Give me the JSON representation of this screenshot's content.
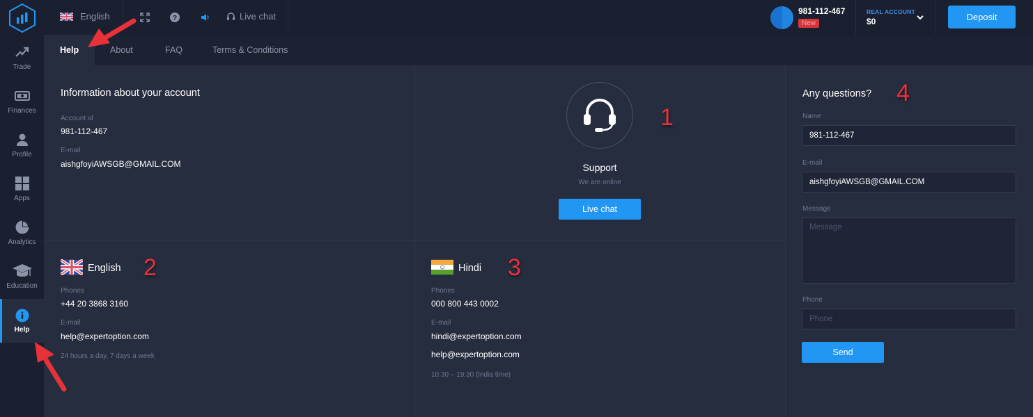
{
  "topbar": {
    "language": "English",
    "live_chat": "Live chat",
    "account_id": "981-112-467",
    "new_badge": "New",
    "account_type": "REAL ACCOUNT",
    "balance": "$0",
    "deposit": "Deposit",
    "icons": [
      "logo-icon",
      "uk-flag-icon",
      "fullscreen-icon",
      "help-icon",
      "sound-icon",
      "headset-icon",
      "chevron-down-icon"
    ]
  },
  "sidebar": {
    "items": [
      {
        "label": "Trade",
        "icon": "trend-up-icon"
      },
      {
        "label": "Finances",
        "icon": "banknote-icon"
      },
      {
        "label": "Profile",
        "icon": "user-icon"
      },
      {
        "label": "Apps",
        "icon": "grid-icon"
      },
      {
        "label": "Analytics",
        "icon": "pie-chart-icon"
      },
      {
        "label": "Education",
        "icon": "graduation-cap-icon"
      },
      {
        "label": "Help",
        "icon": "info-icon",
        "active": true
      }
    ]
  },
  "tabs": [
    {
      "label": "Help",
      "active": true
    },
    {
      "label": "About"
    },
    {
      "label": "FAQ"
    },
    {
      "label": "Terms & Conditions"
    }
  ],
  "account_info": {
    "title": "Information about your account",
    "account_id_label": "Account id",
    "account_id": "981-112-467",
    "email_label": "E-mail",
    "email": "aishgfoyiAWSGB@GMAIL.COM"
  },
  "support": {
    "title": "Support",
    "status": "We are online",
    "button": "Live chat"
  },
  "english_contact": {
    "language": "English",
    "phones_label": "Phones",
    "phone": "+44 20 3868 3160",
    "email_label": "E-mail",
    "email": "help@expertoption.com",
    "hours": "24 hours a day, 7 days a week"
  },
  "hindi_contact": {
    "language": "Hindi",
    "phones_label": "Phones",
    "phone": "000 800 443 0002",
    "email_label": "E-mail",
    "emails": [
      "hindi@expertoption.com",
      "help@expertoption.com"
    ],
    "hours": "10:30 – 19:30 (India time)"
  },
  "questions_form": {
    "title": "Any questions?",
    "name_label": "Name",
    "name_value": "981-112-467",
    "email_label": "E-mail",
    "email_value": "aishgfoyiAWSGB@GMAIL.COM",
    "message_label": "Message",
    "message_placeholder": "Message",
    "phone_label": "Phone",
    "phone_placeholder": "Phone",
    "send": "Send"
  },
  "annotations": [
    "1",
    "2",
    "3",
    "4"
  ],
  "colors": {
    "accent": "#2196f3",
    "background": "#232a3b",
    "topbar": "#1b2030",
    "badge_red": "#d6353c",
    "annotation_red": "#e8323a"
  }
}
